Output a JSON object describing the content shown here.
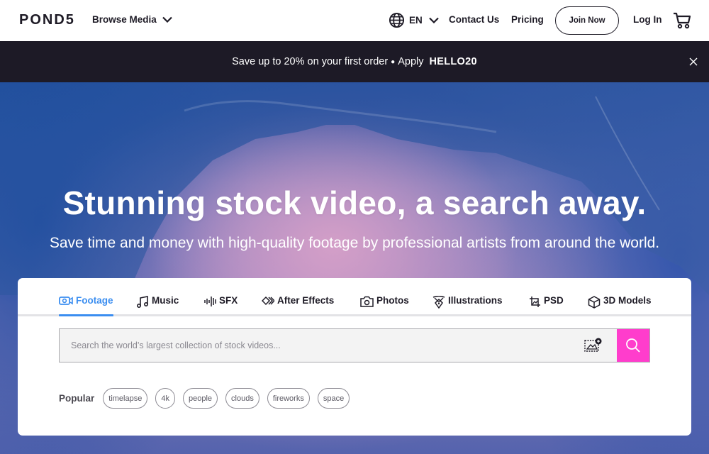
{
  "header": {
    "logo": "POND5",
    "browse_label": "Browse Media",
    "language": "EN",
    "contact_label": "Contact Us",
    "pricing_label": "Pricing",
    "join_label": "Join Now",
    "login_label": "Log In"
  },
  "promo": {
    "text": "Save up to 20% on your first order",
    "separator": "●",
    "apply_label": "Apply",
    "code": "HELLO20"
  },
  "hero": {
    "title": "Stunning stock video, a search away.",
    "subtitle": "Save time and money with high-quality footage by professional artists from around the world."
  },
  "search_card": {
    "tabs": [
      {
        "label": "Footage",
        "icon": "video-camera-icon",
        "active": true
      },
      {
        "label": "Music",
        "icon": "music-note-icon",
        "active": false
      },
      {
        "label": "SFX",
        "icon": "sound-wave-icon",
        "active": false
      },
      {
        "label": "After Effects",
        "icon": "after-effects-icon",
        "active": false
      },
      {
        "label": "Photos",
        "icon": "camera-icon",
        "active": false
      },
      {
        "label": "Illustrations",
        "icon": "pen-nib-icon",
        "active": false
      },
      {
        "label": "PSD",
        "icon": "crop-image-icon",
        "active": false
      },
      {
        "label": "3D Models",
        "icon": "cube-icon",
        "active": false
      }
    ],
    "search_placeholder": "Search the world’s largest collection of stock videos...",
    "search_value": "",
    "popular_label": "Popular",
    "popular_tags": [
      "timelapse",
      "4k",
      "people",
      "clouds",
      "fireworks",
      "space"
    ]
  },
  "colors": {
    "accent_blue": "#3b8ef0",
    "search_button_pink": "#ff3dcc",
    "promo_background": "#1d1a26",
    "text_dark": "#1e1b26"
  }
}
